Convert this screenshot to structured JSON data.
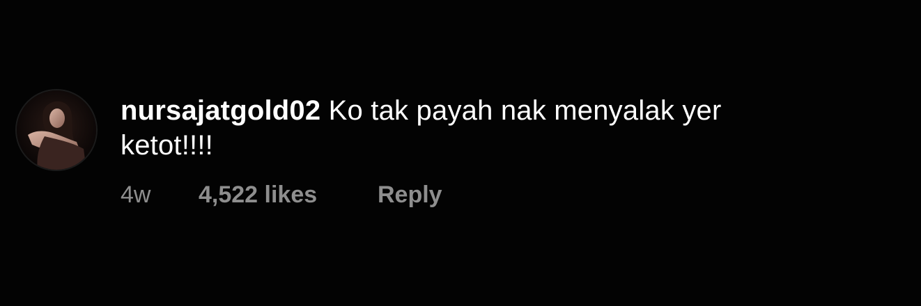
{
  "comment": {
    "username": "nursajatgold02",
    "text": "Ko tak payah nak menyalak yer ketot!!!!",
    "time_ago": "4w",
    "likes_label": "4,522 likes",
    "reply_label": "Reply"
  },
  "icons": {
    "avatar": "profile-photo"
  },
  "colors": {
    "background": "#030303",
    "primary_text": "#ffffff",
    "secondary_text": "#8e8e8e"
  }
}
